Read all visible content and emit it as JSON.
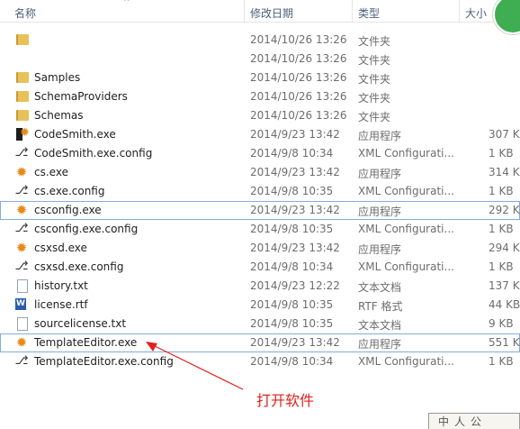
{
  "columns": {
    "name": "名称",
    "date": "修改日期",
    "type": "类型",
    "size": "大小"
  },
  "files": [
    {
      "icon": "folder-icon",
      "name": "",
      "date": "2014/10/26 13:26",
      "type": "文件夹",
      "size": ""
    },
    {
      "icon": "",
      "name": "",
      "date": "2014/10/26 13:26",
      "type": "文件夹",
      "size": ""
    },
    {
      "icon": "folder-icon",
      "name": "Samples",
      "date": "2014/10/26 13:26",
      "type": "文件夹",
      "size": ""
    },
    {
      "icon": "folder-icon",
      "name": "SchemaProviders",
      "date": "2014/10/26 13:26",
      "type": "文件夹",
      "size": ""
    },
    {
      "icon": "folder-icon",
      "name": "Schemas",
      "date": "2014/10/26 13:26",
      "type": "文件夹",
      "size": ""
    },
    {
      "icon": "codesmith-icon",
      "name": "CodeSmith.exe",
      "date": "2014/9/23 13:42",
      "type": "应用程序",
      "size": "307 KB"
    },
    {
      "icon": "config-icon",
      "name": "CodeSmith.exe.config",
      "date": "2014/9/8 10:34",
      "type": "XML Configurati...",
      "size": "1 KB"
    },
    {
      "icon": "gear-icon",
      "name": "cs.exe",
      "date": "2014/9/23 13:42",
      "type": "应用程序",
      "size": "314 KB"
    },
    {
      "icon": "config-icon",
      "name": "cs.exe.config",
      "date": "2014/9/8 10:35",
      "type": "XML Configurati...",
      "size": "1 KB"
    },
    {
      "icon": "gear-icon",
      "name": "csconfig.exe",
      "date": "2014/9/23 13:42",
      "type": "应用程序",
      "size": "292 KB",
      "selected": true
    },
    {
      "icon": "config-icon",
      "name": "csconfig.exe.config",
      "date": "2014/9/8 10:35",
      "type": "XML Configurati...",
      "size": "1 KB"
    },
    {
      "icon": "gear-icon",
      "name": "csxsd.exe",
      "date": "2014/9/23 13:42",
      "type": "应用程序",
      "size": "294 KB"
    },
    {
      "icon": "config-icon",
      "name": "csxsd.exe.config",
      "date": "2014/9/8 10:34",
      "type": "XML Configurati...",
      "size": "1 KB"
    },
    {
      "icon": "text-file-icon",
      "name": "history.txt",
      "date": "2014/9/23 12:22",
      "type": "文本文档",
      "size": "137 KB"
    },
    {
      "icon": "word-doc-icon",
      "name": "license.rtf",
      "date": "2014/9/8 10:35",
      "type": "RTF 格式",
      "size": "44 KB"
    },
    {
      "icon": "text-file-icon",
      "name": "sourcelicense.txt",
      "date": "2014/9/8 10:35",
      "type": "文本文档",
      "size": "9 KB"
    },
    {
      "icon": "gear-icon",
      "name": "TemplateEditor.exe",
      "date": "2014/9/23 13:42",
      "type": "应用程序",
      "size": "551 KB",
      "hovered": true
    },
    {
      "icon": "config-icon",
      "name": "TemplateEditor.exe.config",
      "date": "2014/9/8 10:34",
      "type": "XML Configurati...",
      "size": "1 KB"
    }
  ],
  "annotation": {
    "text": "打开软件",
    "color": "#e3201b"
  },
  "colors": {
    "header_text": "#4c607a",
    "row_highlight_border": "#84acdd",
    "gear_orange": "#e78a1b",
    "folder_yellow": "#e8c158"
  }
}
